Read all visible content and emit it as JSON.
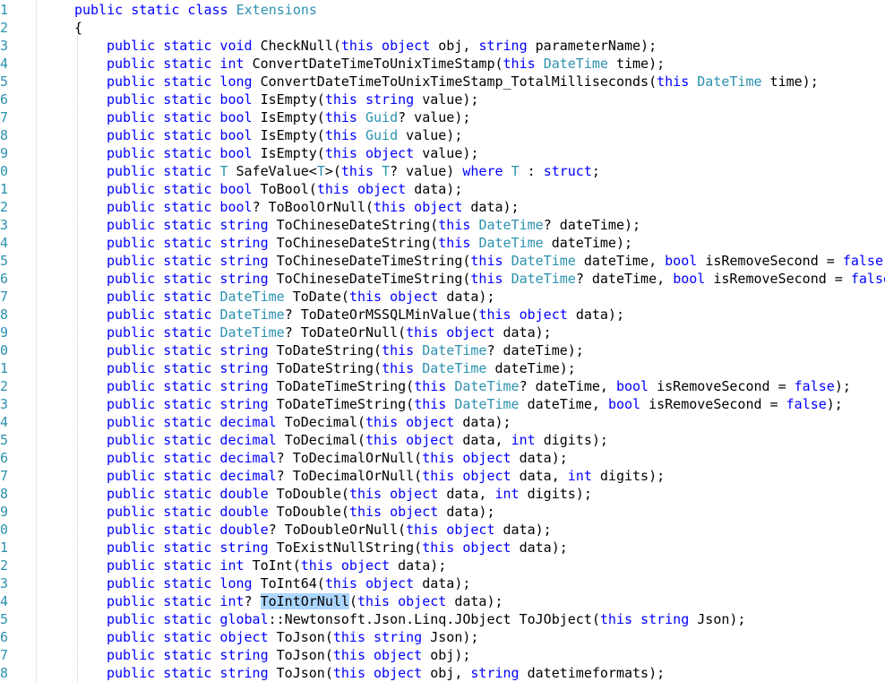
{
  "editor": {
    "colors": {
      "keyword": "#0000ff",
      "type": "#2b91af",
      "plain": "#000000",
      "line_number": "#2b91af",
      "selection": "#add6ff"
    },
    "lines": [
      {
        "number": "1",
        "indent": false,
        "tokens": [
          [
            "kw",
            "public static class "
          ],
          [
            "ty",
            "Extensions"
          ]
        ]
      },
      {
        "number": "2",
        "indent": false,
        "tokens": [
          [
            "pl",
            "{"
          ]
        ]
      },
      {
        "number": "3",
        "indent": true,
        "tokens": [
          [
            "kw",
            "public static void "
          ],
          [
            "pl",
            "CheckNull("
          ],
          [
            "kw",
            "this object "
          ],
          [
            "pl",
            "obj, "
          ],
          [
            "kw",
            "string "
          ],
          [
            "pl",
            "parameterName);"
          ]
        ]
      },
      {
        "number": "4",
        "indent": true,
        "tokens": [
          [
            "kw",
            "public static int "
          ],
          [
            "pl",
            "ConvertDateTimeToUnixTimeStamp("
          ],
          [
            "kw",
            "this "
          ],
          [
            "ty",
            "DateTime "
          ],
          [
            "pl",
            "time);"
          ]
        ]
      },
      {
        "number": "5",
        "indent": true,
        "tokens": [
          [
            "kw",
            "public static long "
          ],
          [
            "pl",
            "ConvertDateTimeToUnixTimeStamp_TotalMilliseconds("
          ],
          [
            "kw",
            "this "
          ],
          [
            "ty",
            "DateTime "
          ],
          [
            "pl",
            "time);"
          ]
        ]
      },
      {
        "number": "6",
        "indent": true,
        "tokens": [
          [
            "kw",
            "public static bool "
          ],
          [
            "pl",
            "IsEmpty("
          ],
          [
            "kw",
            "this string "
          ],
          [
            "pl",
            "value);"
          ]
        ]
      },
      {
        "number": "7",
        "indent": true,
        "tokens": [
          [
            "kw",
            "public static bool "
          ],
          [
            "pl",
            "IsEmpty("
          ],
          [
            "kw",
            "this "
          ],
          [
            "ty",
            "Guid"
          ],
          [
            "pl",
            "? value);"
          ]
        ]
      },
      {
        "number": "8",
        "indent": true,
        "tokens": [
          [
            "kw",
            "public static bool "
          ],
          [
            "pl",
            "IsEmpty("
          ],
          [
            "kw",
            "this "
          ],
          [
            "ty",
            "Guid "
          ],
          [
            "pl",
            "value);"
          ]
        ]
      },
      {
        "number": "9",
        "indent": true,
        "tokens": [
          [
            "kw",
            "public static bool "
          ],
          [
            "pl",
            "IsEmpty("
          ],
          [
            "kw",
            "this object "
          ],
          [
            "pl",
            "value);"
          ]
        ]
      },
      {
        "number": "0",
        "indent": true,
        "tokens": [
          [
            "kw",
            "public static "
          ],
          [
            "ty",
            "T "
          ],
          [
            "pl",
            "SafeValue<"
          ],
          [
            "ty",
            "T"
          ],
          [
            "pl",
            ">("
          ],
          [
            "kw",
            "this "
          ],
          [
            "ty",
            "T"
          ],
          [
            "pl",
            "? value) "
          ],
          [
            "kw",
            "where "
          ],
          [
            "ty",
            "T "
          ],
          [
            "pl",
            ": "
          ],
          [
            "kw",
            "struct"
          ],
          [
            "pl",
            ";"
          ]
        ]
      },
      {
        "number": "1",
        "indent": true,
        "tokens": [
          [
            "kw",
            "public static bool "
          ],
          [
            "pl",
            "ToBool("
          ],
          [
            "kw",
            "this object "
          ],
          [
            "pl",
            "data);"
          ]
        ]
      },
      {
        "number": "2",
        "indent": true,
        "tokens": [
          [
            "kw",
            "public static bool"
          ],
          [
            "pl",
            "? ToBoolOrNull("
          ],
          [
            "kw",
            "this object "
          ],
          [
            "pl",
            "data);"
          ]
        ]
      },
      {
        "number": "3",
        "indent": true,
        "tokens": [
          [
            "kw",
            "public static string "
          ],
          [
            "pl",
            "ToChineseDateString("
          ],
          [
            "kw",
            "this "
          ],
          [
            "ty",
            "DateTime"
          ],
          [
            "pl",
            "? dateTime);"
          ]
        ]
      },
      {
        "number": "4",
        "indent": true,
        "tokens": [
          [
            "kw",
            "public static string "
          ],
          [
            "pl",
            "ToChineseDateString("
          ],
          [
            "kw",
            "this "
          ],
          [
            "ty",
            "DateTime "
          ],
          [
            "pl",
            "dateTime);"
          ]
        ]
      },
      {
        "number": "5",
        "indent": true,
        "tokens": [
          [
            "kw",
            "public static string "
          ],
          [
            "pl",
            "ToChineseDateTimeString("
          ],
          [
            "kw",
            "this "
          ],
          [
            "ty",
            "DateTime "
          ],
          [
            "pl",
            "dateTime, "
          ],
          [
            "kw",
            "bool "
          ],
          [
            "pl",
            "isRemoveSecond = "
          ],
          [
            "kw",
            "false"
          ],
          [
            "pl",
            ");"
          ]
        ]
      },
      {
        "number": "6",
        "indent": true,
        "tokens": [
          [
            "kw",
            "public static string "
          ],
          [
            "pl",
            "ToChineseDateTimeString("
          ],
          [
            "kw",
            "this "
          ],
          [
            "ty",
            "DateTime"
          ],
          [
            "pl",
            "? dateTime, "
          ],
          [
            "kw",
            "bool "
          ],
          [
            "pl",
            "isRemoveSecond = "
          ],
          [
            "kw",
            "false"
          ],
          [
            "pl",
            ");"
          ]
        ]
      },
      {
        "number": "7",
        "indent": true,
        "tokens": [
          [
            "kw",
            "public static "
          ],
          [
            "ty",
            "DateTime "
          ],
          [
            "pl",
            "ToDate("
          ],
          [
            "kw",
            "this object "
          ],
          [
            "pl",
            "data);"
          ]
        ]
      },
      {
        "number": "8",
        "indent": true,
        "tokens": [
          [
            "kw",
            "public static "
          ],
          [
            "ty",
            "DateTime"
          ],
          [
            "pl",
            "? ToDateOrMSSQLMinValue("
          ],
          [
            "kw",
            "this object "
          ],
          [
            "pl",
            "data);"
          ]
        ]
      },
      {
        "number": "9",
        "indent": true,
        "tokens": [
          [
            "kw",
            "public static "
          ],
          [
            "ty",
            "DateTime"
          ],
          [
            "pl",
            "? ToDateOrNull("
          ],
          [
            "kw",
            "this object "
          ],
          [
            "pl",
            "data);"
          ]
        ]
      },
      {
        "number": "0",
        "indent": true,
        "tokens": [
          [
            "kw",
            "public static string "
          ],
          [
            "pl",
            "ToDateString("
          ],
          [
            "kw",
            "this "
          ],
          [
            "ty",
            "DateTime"
          ],
          [
            "pl",
            "? dateTime);"
          ]
        ]
      },
      {
        "number": "1",
        "indent": true,
        "tokens": [
          [
            "kw",
            "public static string "
          ],
          [
            "pl",
            "ToDateString("
          ],
          [
            "kw",
            "this "
          ],
          [
            "ty",
            "DateTime "
          ],
          [
            "pl",
            "dateTime);"
          ]
        ]
      },
      {
        "number": "2",
        "indent": true,
        "tokens": [
          [
            "kw",
            "public static string "
          ],
          [
            "pl",
            "ToDateTimeString("
          ],
          [
            "kw",
            "this "
          ],
          [
            "ty",
            "DateTime"
          ],
          [
            "pl",
            "? dateTime, "
          ],
          [
            "kw",
            "bool "
          ],
          [
            "pl",
            "isRemoveSecond = "
          ],
          [
            "kw",
            "false"
          ],
          [
            "pl",
            ");"
          ]
        ]
      },
      {
        "number": "3",
        "indent": true,
        "tokens": [
          [
            "kw",
            "public static string "
          ],
          [
            "pl",
            "ToDateTimeString("
          ],
          [
            "kw",
            "this "
          ],
          [
            "ty",
            "DateTime "
          ],
          [
            "pl",
            "dateTime, "
          ],
          [
            "kw",
            "bool "
          ],
          [
            "pl",
            "isRemoveSecond = "
          ],
          [
            "kw",
            "false"
          ],
          [
            "pl",
            ");"
          ]
        ]
      },
      {
        "number": "4",
        "indent": true,
        "tokens": [
          [
            "kw",
            "public static decimal "
          ],
          [
            "pl",
            "ToDecimal("
          ],
          [
            "kw",
            "this object "
          ],
          [
            "pl",
            "data);"
          ]
        ]
      },
      {
        "number": "5",
        "indent": true,
        "tokens": [
          [
            "kw",
            "public static decimal "
          ],
          [
            "pl",
            "ToDecimal("
          ],
          [
            "kw",
            "this object "
          ],
          [
            "pl",
            "data, "
          ],
          [
            "kw",
            "int "
          ],
          [
            "pl",
            "digits);"
          ]
        ]
      },
      {
        "number": "6",
        "indent": true,
        "tokens": [
          [
            "kw",
            "public static decimal"
          ],
          [
            "pl",
            "? ToDecimalOrNull("
          ],
          [
            "kw",
            "this object "
          ],
          [
            "pl",
            "data);"
          ]
        ]
      },
      {
        "number": "7",
        "indent": true,
        "tokens": [
          [
            "kw",
            "public static decimal"
          ],
          [
            "pl",
            "? ToDecimalOrNull("
          ],
          [
            "kw",
            "this object "
          ],
          [
            "pl",
            "data, "
          ],
          [
            "kw",
            "int "
          ],
          [
            "pl",
            "digits);"
          ]
        ]
      },
      {
        "number": "8",
        "indent": true,
        "tokens": [
          [
            "kw",
            "public static double "
          ],
          [
            "pl",
            "ToDouble("
          ],
          [
            "kw",
            "this object "
          ],
          [
            "pl",
            "data, "
          ],
          [
            "kw",
            "int "
          ],
          [
            "pl",
            "digits);"
          ]
        ]
      },
      {
        "number": "9",
        "indent": true,
        "tokens": [
          [
            "kw",
            "public static double "
          ],
          [
            "pl",
            "ToDouble("
          ],
          [
            "kw",
            "this object "
          ],
          [
            "pl",
            "data);"
          ]
        ]
      },
      {
        "number": "0",
        "indent": true,
        "tokens": [
          [
            "kw",
            "public static double"
          ],
          [
            "pl",
            "? ToDoubleOrNull("
          ],
          [
            "kw",
            "this object "
          ],
          [
            "pl",
            "data);"
          ]
        ]
      },
      {
        "number": "1",
        "indent": true,
        "tokens": [
          [
            "kw",
            "public static string "
          ],
          [
            "pl",
            "ToExistNullString("
          ],
          [
            "kw",
            "this object "
          ],
          [
            "pl",
            "data);"
          ]
        ]
      },
      {
        "number": "2",
        "indent": true,
        "tokens": [
          [
            "kw",
            "public static int "
          ],
          [
            "pl",
            "ToInt("
          ],
          [
            "kw",
            "this object "
          ],
          [
            "pl",
            "data);"
          ]
        ]
      },
      {
        "number": "3",
        "indent": true,
        "tokens": [
          [
            "kw",
            "public static long "
          ],
          [
            "pl",
            "ToInt64("
          ],
          [
            "kw",
            "this object "
          ],
          [
            "pl",
            "data);"
          ]
        ]
      },
      {
        "number": "4",
        "indent": true,
        "tokens": [
          [
            "kw",
            "public static int"
          ],
          [
            "pl",
            "? "
          ],
          [
            "sel",
            "ToIntOrNull"
          ],
          [
            "pl",
            "("
          ],
          [
            "kw",
            "this object "
          ],
          [
            "pl",
            "data);"
          ]
        ]
      },
      {
        "number": "5",
        "indent": true,
        "tokens": [
          [
            "kw",
            "public static global"
          ],
          [
            "pl",
            "::Newtonsoft.Json.Linq.JObject ToJObject("
          ],
          [
            "kw",
            "this string "
          ],
          [
            "pl",
            "Json);"
          ]
        ]
      },
      {
        "number": "6",
        "indent": true,
        "tokens": [
          [
            "kw",
            "public static object "
          ],
          [
            "pl",
            "ToJson("
          ],
          [
            "kw",
            "this string "
          ],
          [
            "pl",
            "Json);"
          ]
        ]
      },
      {
        "number": "7",
        "indent": true,
        "tokens": [
          [
            "kw",
            "public static string "
          ],
          [
            "pl",
            "ToJson("
          ],
          [
            "kw",
            "this object "
          ],
          [
            "pl",
            "obj);"
          ]
        ]
      },
      {
        "number": "8",
        "indent": true,
        "tokens": [
          [
            "kw",
            "public static string "
          ],
          [
            "pl",
            "ToJson("
          ],
          [
            "kw",
            "this object "
          ],
          [
            "pl",
            "obj, "
          ],
          [
            "kw",
            "string "
          ],
          [
            "pl",
            "datetimeformats);"
          ]
        ]
      }
    ]
  }
}
